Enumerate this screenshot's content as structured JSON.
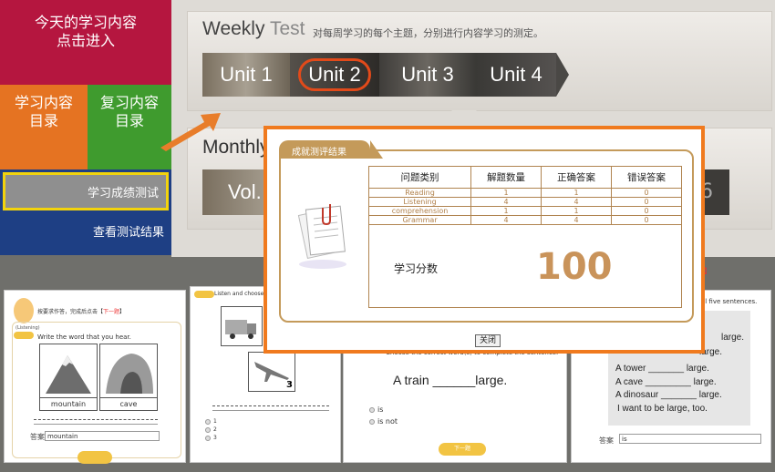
{
  "nav": {
    "today": "今天的学习内容\n点击进入",
    "today_l1": "今天的学习内容",
    "today_l2": "点击进入",
    "learn_l1": "学习内容",
    "learn_l2": "目录",
    "review_l1": "复习内容",
    "review_l2": "目录",
    "score": "学习成绩测试",
    "view_results": "查看测试结果"
  },
  "weekly": {
    "title_a": "Weekly",
    "title_b": "Test",
    "desc": "对每周学习的每个主题，分别进行内容学习的测定。",
    "units": [
      "Unit 1",
      "Unit 2",
      "Unit 3",
      "Unit 4"
    ],
    "selected_unit": "Unit 2"
  },
  "monthly": {
    "title": "Monthly",
    "vol": "Vol.",
    "vol_right": "6"
  },
  "thumbs": {
    "t1_hint_a": "按要求作答，完成后点击【",
    "t1_hint_b": "下一题",
    "t1_hint_c": "】",
    "t1_listen": "(Listening)",
    "t1_instr": "Write the word that you hear.",
    "t1_pic1": "mountain",
    "t1_pic2": "cave",
    "t1_answer_label": "答案",
    "t1_answer_value": "mountain",
    "t2_instr": "Listen and choose th",
    "t2_opts": [
      "1",
      "2",
      "3"
    ],
    "t2_num": "3",
    "t3_choose": "Choose the correct word(s) to complete the sentence.",
    "t3_sentence": "A train ______large.",
    "t3_choice1": "is",
    "t3_choice2": "is not",
    "t3_next": "下一题",
    "t4_top": "all five sentences.",
    "t4_lines": [
      "large.",
      "large.",
      "A tower _______ large.",
      "A cave _________ large.",
      "A dinosaur _______ large.",
      "I want to be large, too."
    ],
    "t4_answer_label": "答案",
    "t4_answer_value": "is",
    "t4_bracket": "】"
  },
  "modal": {
    "tab": "成就测评结果",
    "headers": [
      "问题类别",
      "解题数量",
      "正确答案",
      "错误答案"
    ],
    "rows": [
      [
        "Reading",
        "1",
        "1",
        "0"
      ],
      [
        "Listening",
        "4",
        "4",
        "0"
      ],
      [
        "comprehension",
        "1",
        "1",
        "0"
      ],
      [
        "Grammar",
        "4",
        "4",
        "0"
      ]
    ],
    "score_label": "学习分数",
    "score": "100",
    "close": "关闭"
  }
}
